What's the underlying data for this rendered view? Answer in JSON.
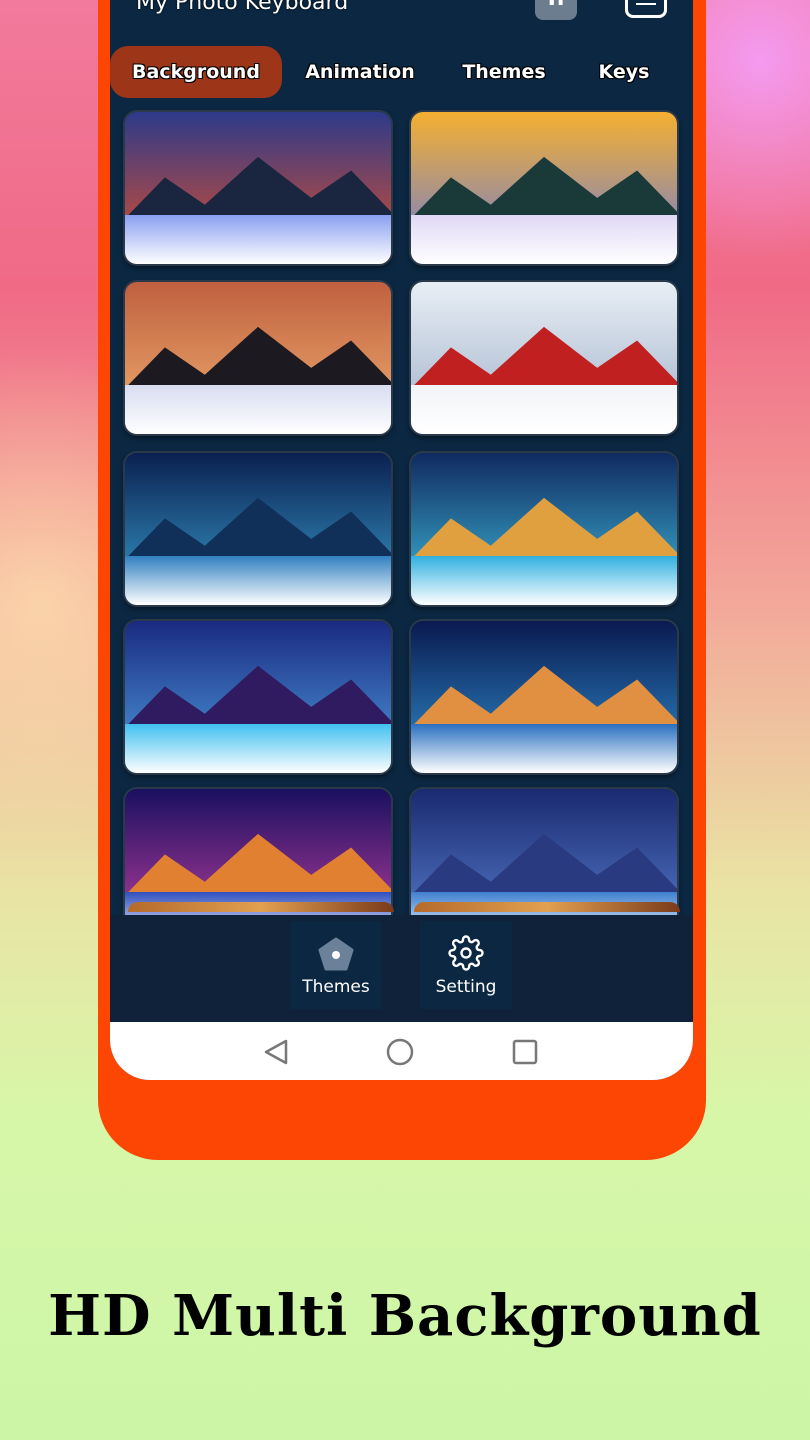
{
  "app": {
    "title": "My Photo Keyboard",
    "font_icon": "Tr"
  },
  "tabs": [
    {
      "label": "Background",
      "active": true
    },
    {
      "label": "Animation"
    },
    {
      "label": "Themes"
    },
    {
      "label": "Keys"
    }
  ],
  "colors": {
    "frame": "#fd4504",
    "screen": "#0b2741",
    "active_tab": "#9d3519"
  },
  "wallpapers": [
    {
      "sky": "#2d3a8a",
      "sky2": "#e0502a",
      "mtn": "#1a2540",
      "snow": "#8aa0f0"
    },
    {
      "sky": "#f5b030",
      "sky2": "#6a7ad8",
      "mtn": "#1a3a3a",
      "snow": "#e0d8f5"
    },
    {
      "sky": "#c06040",
      "sky2": "#f0b070",
      "mtn": "#1c1a20",
      "snow": "#d8dcf0"
    },
    {
      "sky": "#e8eef5",
      "sky2": "#9fb0c8",
      "mtn": "#c02020",
      "snow": "#f2f4f8"
    },
    {
      "sky": "#0a2050",
      "sky2": "#3aa0d0",
      "mtn": "#10305a",
      "snow": "#3080c0"
    },
    {
      "sky": "#102a60",
      "sky2": "#40c0e0",
      "mtn": "#e0a040",
      "snow": "#30b0e0"
    },
    {
      "sky": "#1a2a80",
      "sky2": "#50a0e0",
      "mtn": "#301a60",
      "snow": "#40c0f0"
    },
    {
      "sky": "#0a1a50",
      "sky2": "#3090d0",
      "mtn": "#e09040",
      "snow": "#2a70c0"
    },
    {
      "sky": "#1a1060",
      "sky2": "#c040a0",
      "mtn": "#e08030",
      "snow": "#3050c0"
    },
    {
      "sky": "#1a2a70",
      "sky2": "#5a80d0",
      "mtn": "#2a3a80",
      "snow": "#4080d0"
    }
  ],
  "bottom_nav": [
    {
      "label": "Themes",
      "icon": "pentagon-icon"
    },
    {
      "label": "Setting",
      "icon": "gear-icon"
    }
  ],
  "caption": "HD Multi Background"
}
